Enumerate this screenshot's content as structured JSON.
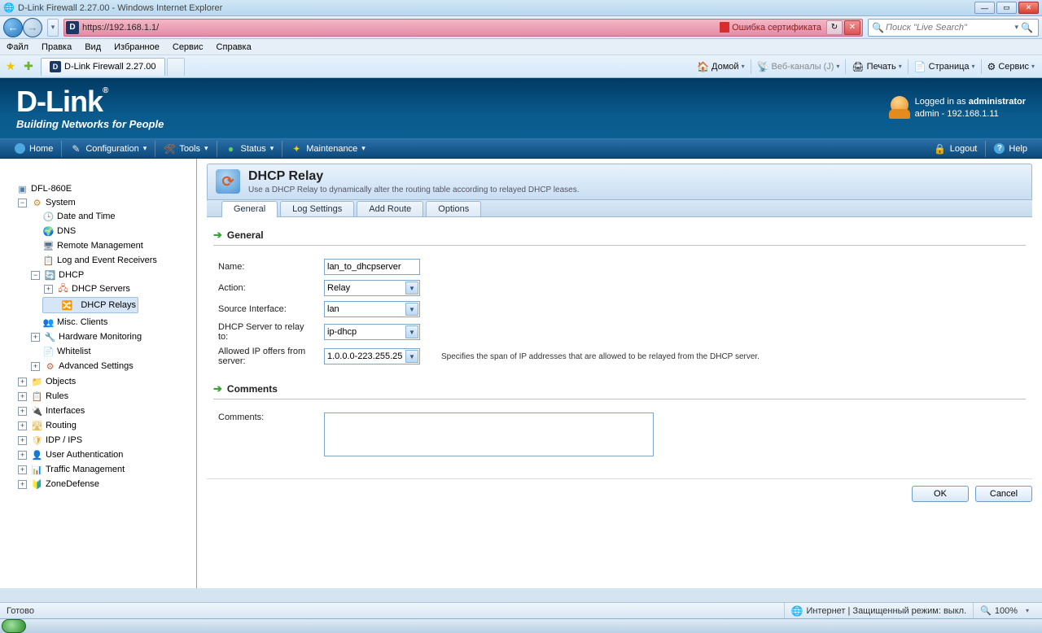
{
  "window": {
    "title": "D-Link Firewall 2.27.00 - Windows Internet Explorer",
    "url": "https://192.168.1.1/",
    "cert_error": "Ошибка сертификата",
    "search_placeholder": "Поиск \"Live Search\"",
    "tab_label": "D-Link Firewall 2.27.00"
  },
  "ie_menu": [
    "Файл",
    "Правка",
    "Вид",
    "Избранное",
    "Сервис",
    "Справка"
  ],
  "ie_toolbar": {
    "home": "Домой",
    "feeds": "Веб-каналы (J)",
    "print": "Печать",
    "page": "Страница",
    "tools": "Сервис"
  },
  "header": {
    "brand": "D-Link",
    "tagline": "Building Networks for People",
    "logged_in_prefix": "Logged in as ",
    "logged_in_user": "administrator",
    "user_line2": "admin - 192.168.1.11"
  },
  "menu": {
    "home": "Home",
    "configuration": "Configuration",
    "tools": "Tools",
    "status": "Status",
    "maintenance": "Maintenance",
    "logout": "Logout",
    "help": "Help"
  },
  "tree": {
    "root": "DFL-860E",
    "system": "System",
    "date_time": "Date and Time",
    "dns": "DNS",
    "remote_mgmt": "Remote Management",
    "log_recv": "Log and Event Receivers",
    "dhcp": "DHCP",
    "dhcp_servers": "DHCP Servers",
    "dhcp_relays": "DHCP Relays",
    "misc_clients": "Misc. Clients",
    "hw_mon": "Hardware Monitoring",
    "whitelist": "Whitelist",
    "adv_settings": "Advanced Settings",
    "objects": "Objects",
    "rules": "Rules",
    "interfaces": "Interfaces",
    "routing": "Routing",
    "idp": "IDP / IPS",
    "user_auth": "User Authentication",
    "traffic_mgmt": "Traffic Management",
    "zonedefense": "ZoneDefense"
  },
  "page": {
    "title": "DHCP Relay",
    "desc": "Use a DHCP Relay to dynamically alter the routing table according to relayed DHCP leases.",
    "tabs": [
      "General",
      "Log Settings",
      "Add Route",
      "Options"
    ],
    "active_tab": 0,
    "section_general": "General",
    "section_comments": "Comments",
    "labels": {
      "name": "Name:",
      "action": "Action:",
      "src_if": "Source Interface:",
      "server": "DHCP Server to relay to:",
      "allowed": "Allowed IP offers from server:",
      "comments": "Comments:",
      "allowed_help": "Specifies the span of IP addresses that are allowed to be relayed from the DHCP server."
    },
    "values": {
      "name": "lan_to_dhcpserver",
      "action": "Relay",
      "src_if": "lan",
      "server": "ip-dhcp",
      "allowed": "1.0.0.0-223.255.25",
      "comments": ""
    },
    "buttons": {
      "ok": "OK",
      "cancel": "Cancel"
    }
  },
  "status": {
    "ready": "Готово",
    "zone": "Интернет | Защищенный режим: выкл.",
    "zoom": "100%"
  }
}
